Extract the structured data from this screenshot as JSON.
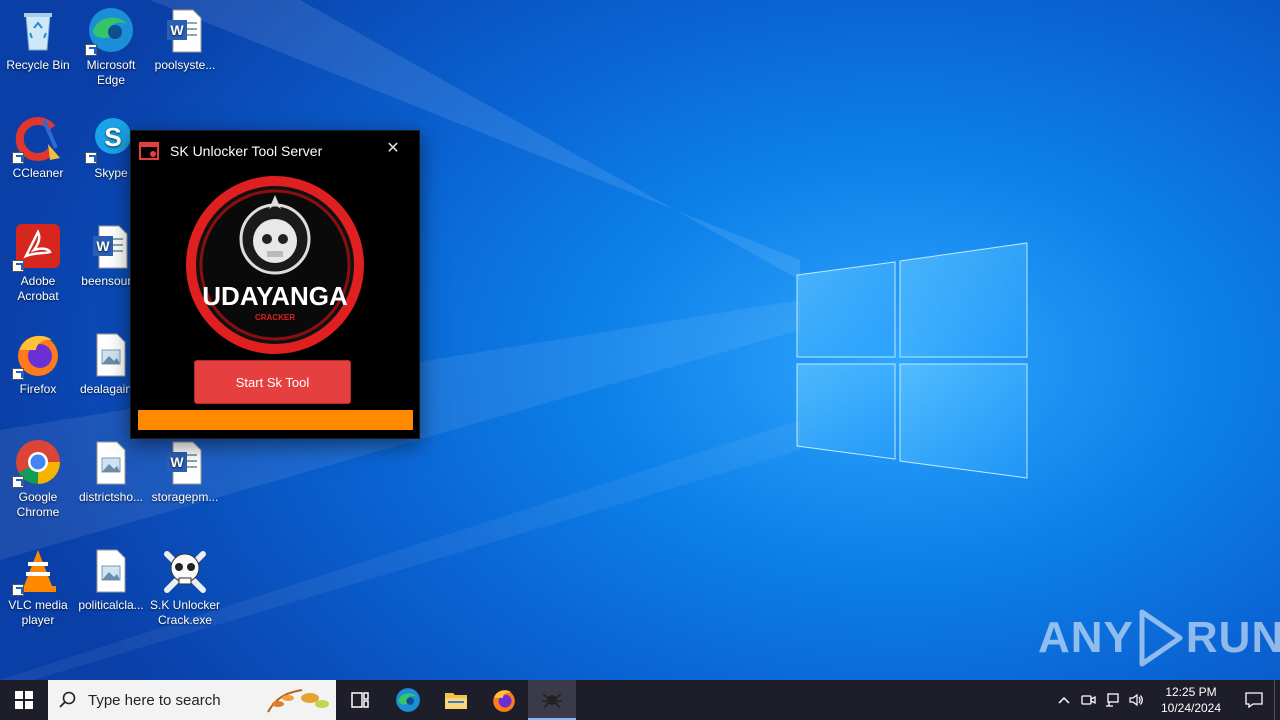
{
  "desktop": {
    "icons": [
      {
        "label": "Recycle Bin"
      },
      {
        "label": "Microsoft Edge"
      },
      {
        "label": "poolsyste..."
      },
      {
        "label": "CCleaner"
      },
      {
        "label": "Skype"
      },
      {
        "label": "Adobe Acrobat"
      },
      {
        "label": "beensour..."
      },
      {
        "label": "Firefox"
      },
      {
        "label": "dealagain..."
      },
      {
        "label": "Google Chrome"
      },
      {
        "label": "districtsho..."
      },
      {
        "label": "storagepm..."
      },
      {
        "label": "VLC media player"
      },
      {
        "label": "politicalcla..."
      },
      {
        "label": "S.K Unlocker Crack.exe"
      }
    ]
  },
  "dialog": {
    "title": "SK Unlocker Tool Server",
    "close_glyph": "✕",
    "logo_text": "UDAYANGA",
    "logo_subtext": "CRACKER",
    "start_button": "Start Sk Tool",
    "progress": 1.0,
    "progress_color": "#ff8a00",
    "button_color": "#e53f3f"
  },
  "watermark": {
    "left": "ANY",
    "right": "RUN"
  },
  "taskbar": {
    "search_placeholder": "Type here to search",
    "clock_time": "12:25 PM",
    "clock_date": "10/24/2024",
    "apps": [
      "task-view",
      "edge",
      "file-explorer",
      "firefox",
      "sk-unlocker"
    ]
  }
}
